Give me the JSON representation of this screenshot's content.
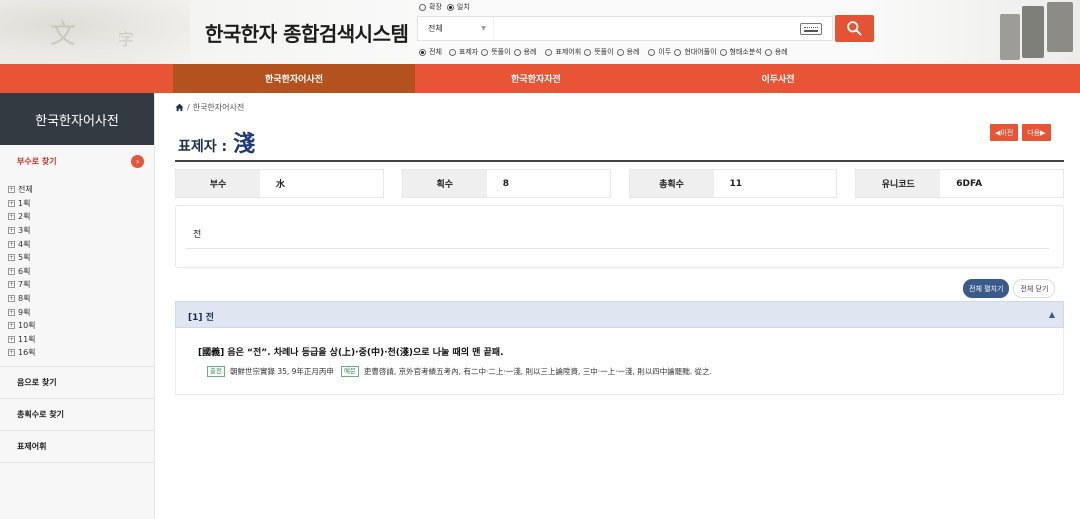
{
  "header": {
    "title": "한국한자 종합검색시스템",
    "match_options": [
      {
        "label": "확장",
        "selected": false
      },
      {
        "label": "일치",
        "selected": true
      }
    ],
    "scope_options": [
      {
        "label": "전체",
        "selected": true
      },
      {
        "label": "표제자",
        "selected": false
      },
      {
        "label": "뜻풀이",
        "selected": false
      },
      {
        "label": "용례",
        "selected": false
      },
      {
        "label": "표제어휘",
        "selected": false
      },
      {
        "label": "뜻풀이",
        "selected": false
      },
      {
        "label": "용례",
        "selected": false
      },
      {
        "label": "이두",
        "selected": false
      },
      {
        "label": "현대어풀이",
        "selected": false
      },
      {
        "label": "형태소분석",
        "selected": false
      },
      {
        "label": "용례",
        "selected": false
      }
    ],
    "search": {
      "category": "전체",
      "value": "",
      "placeholder": ""
    },
    "icons": {
      "keyboard": "keyboard-icon",
      "search": "search-icon"
    }
  },
  "nav": {
    "items": [
      {
        "label": "한국한자어사전",
        "active": true
      },
      {
        "label": "한국한자자전",
        "active": false
      },
      {
        "label": "이두사전",
        "active": false
      }
    ]
  },
  "sidebar": {
    "title": "한국한자어사전",
    "radical_search": "부수로 찾기",
    "tree": [
      "전체",
      "1획",
      "2획",
      "3획",
      "4획",
      "5획",
      "6획",
      "7획",
      "8획",
      "9획",
      "10획",
      "11획",
      "16획"
    ],
    "sound_search": "음으로 찾기",
    "stroke_search": "총획수로 찾기",
    "headword": "표제어휘"
  },
  "main": {
    "breadcrumb": "한국한자어사전",
    "heading_label": "표제자 :",
    "heading_char": "淺",
    "prev_label": "◀이전",
    "next_label": "다음▶",
    "info": {
      "radical_label": "부수",
      "radical_value": "水",
      "strokes_label": "획수",
      "strokes_value": "8",
      "total_label": "총획수",
      "total_value": "11",
      "unicode_label": "유니코드",
      "unicode_value": "6DFA"
    },
    "reading": "전",
    "expand_all": "전체 펼치기",
    "collapse_all": "전체 닫기",
    "entry": {
      "title": "[1] 전",
      "meaning": "[國義]  음은 “전”. 차례나 등급을 상(上)·중(中)·천(淺)으로 나눌 때의 맨 끝패.",
      "source_tag": "출전",
      "source": "朝鮮世宗實錄 35, 9年正月丙申",
      "example_tag": "예문",
      "example": "吏曹啓請, 京外官考績五考內, 有二中·二上·一淺, 則以三上論陞資, 三中·一上·一淺, 則以四中論罷黜. 從之."
    }
  },
  "colors": {
    "accent": "#e85436",
    "active_nav": "#b3521e",
    "sidebar_dark": "#343a42",
    "accordion": "#dfe6f2"
  }
}
